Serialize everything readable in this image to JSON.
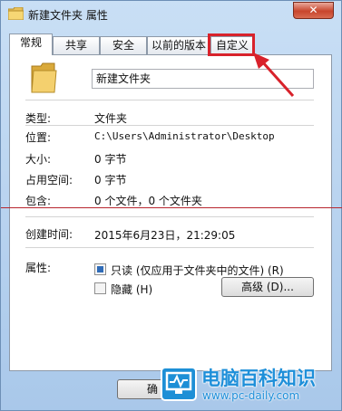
{
  "window": {
    "title": "新建文件夹 属性",
    "close_label": "✕"
  },
  "tabs": [
    {
      "label": "常规",
      "active": true
    },
    {
      "label": "共享",
      "active": false
    },
    {
      "label": "安全",
      "active": false
    },
    {
      "label": "以前的版本",
      "active": false
    },
    {
      "label": "自定义",
      "active": false
    }
  ],
  "general": {
    "folder_name": "新建文件夹",
    "type_label": "类型:",
    "type_value": "文件夹",
    "location_label": "位置:",
    "location_value": "C:\\Users\\Administrator\\Desktop",
    "size_label": "大小:",
    "size_value": "0 字节",
    "size_on_disk_label": "占用空间:",
    "size_on_disk_value": "0 字节",
    "contains_label": "包含:",
    "contains_value": "0 个文件，0 个文件夹",
    "created_label": "创建时间:",
    "created_value": "2015年6月23日，21:29:05",
    "attributes_label": "属性:",
    "readonly_label": "只读 (仅应用于文件夹中的文件) (R)",
    "readonly_state": "indeterminate",
    "hidden_label": "隐藏 (H)",
    "hidden_state": "unchecked",
    "advanced_button": "高级 (D)..."
  },
  "footer": {
    "ok_button": "确"
  },
  "watermark": {
    "title": "电脑百科知识",
    "url": "www.pc-daily.com"
  },
  "colors": {
    "highlight": "#d8222b",
    "brand": "#1e8fd9",
    "checkbox_fill": "#2f6bb7"
  }
}
